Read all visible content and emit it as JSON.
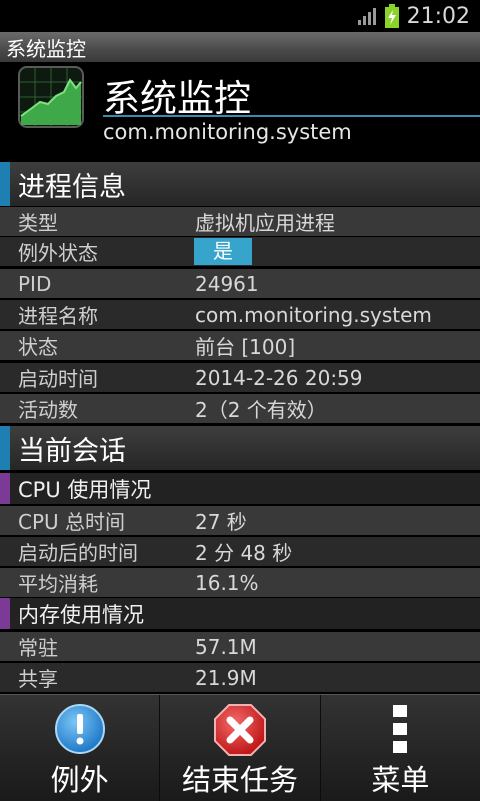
{
  "status_bar": {
    "time": "21:02"
  },
  "title_bar": {
    "title": "系统监控"
  },
  "app": {
    "name": "系统监控",
    "package": "com.monitoring.system"
  },
  "process_section": {
    "title": "进程信息",
    "rows": [
      {
        "label": "类型",
        "value": "虚拟机应用进程"
      },
      {
        "label": "例外状态",
        "value": "是"
      },
      {
        "label": "PID",
        "value": "24961"
      },
      {
        "label": "进程名称",
        "value": "com.monitoring.system"
      },
      {
        "label": "状态",
        "value": "前台 [100]"
      },
      {
        "label": "启动时间",
        "value": "2014-2-26 20:59"
      },
      {
        "label": "活动数",
        "value": "2（2 个有效）"
      }
    ]
  },
  "session_section": {
    "title": "当前会话",
    "cpu": {
      "title": "CPU 使用情况",
      "rows": [
        {
          "label": "CPU 总时间",
          "value": "27 秒"
        },
        {
          "label": "启动后的时间",
          "value": "2 分 48 秒"
        },
        {
          "label": "平均消耗",
          "value": "16.1%"
        }
      ]
    },
    "memory": {
      "title": "内存使用情况",
      "rows": [
        {
          "label": "常驻",
          "value": "57.1M"
        },
        {
          "label": "共享",
          "value": "21.9M"
        }
      ]
    }
  },
  "bottom_bar": {
    "exception_label": "例外",
    "end_task_label": "结束任务",
    "menu_label": "菜单"
  },
  "icons": {
    "exception": "info-icon",
    "end_task": "close-icon",
    "menu": "more-vertical-icon"
  },
  "colors": {
    "accent": "#1e7fb2",
    "sub_accent": "#7a3a96",
    "badge": "#37a4cc"
  }
}
